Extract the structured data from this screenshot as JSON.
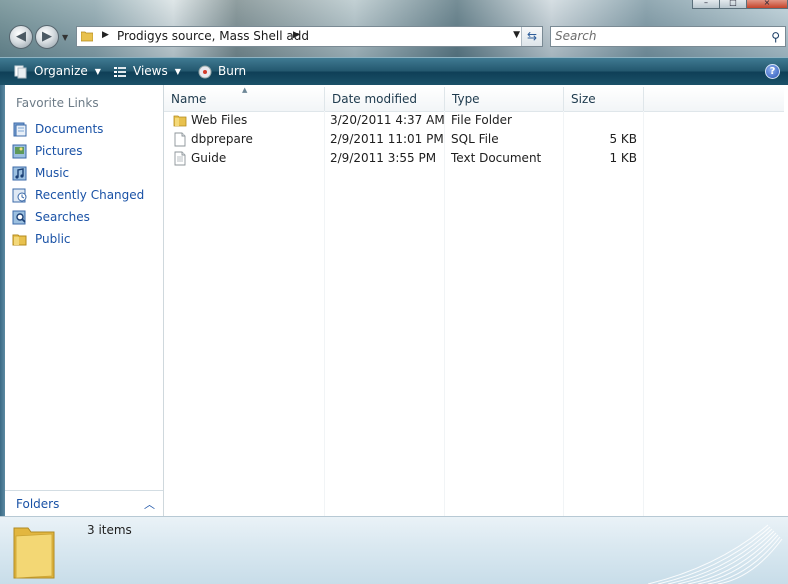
{
  "address_bar": {
    "path": "Prodigys source, Mass Shell add",
    "separator": "▶"
  },
  "search": {
    "placeholder": "Search"
  },
  "toolbar": {
    "organize_label": "Organize",
    "views_label": "Views",
    "burn_label": "Burn",
    "help_label": "?"
  },
  "nav_pane": {
    "favorites_title": "Favorite Links",
    "items": [
      {
        "label": "Documents",
        "icon": "documents-icon"
      },
      {
        "label": "Pictures",
        "icon": "pictures-icon"
      },
      {
        "label": "Music",
        "icon": "music-icon"
      },
      {
        "label": "Recently Changed",
        "icon": "recently-changed-icon"
      },
      {
        "label": "Searches",
        "icon": "searches-icon"
      },
      {
        "label": "Public",
        "icon": "public-folder-icon"
      }
    ],
    "folders_label": "Folders"
  },
  "columns": {
    "name": "Name",
    "date": "Date modified",
    "type": "Type",
    "size": "Size"
  },
  "files": [
    {
      "name": "Web Files",
      "date": "3/20/2011 4:37 AM",
      "type": "File Folder",
      "size": "",
      "icon": "folder-icon"
    },
    {
      "name": "dbprepare",
      "date": "2/9/2011 11:01 PM",
      "type": "SQL File",
      "size": "5 KB",
      "icon": "document-icon"
    },
    {
      "name": "Guide",
      "date": "2/9/2011 3:55 PM",
      "type": "Text Document",
      "size": "1 KB",
      "icon": "text-document-icon"
    }
  ],
  "details": {
    "item_count": "3 items"
  },
  "colors": {
    "toolbar": "#24586f",
    "link": "#1a52a6",
    "folder": "#e8c14e"
  }
}
